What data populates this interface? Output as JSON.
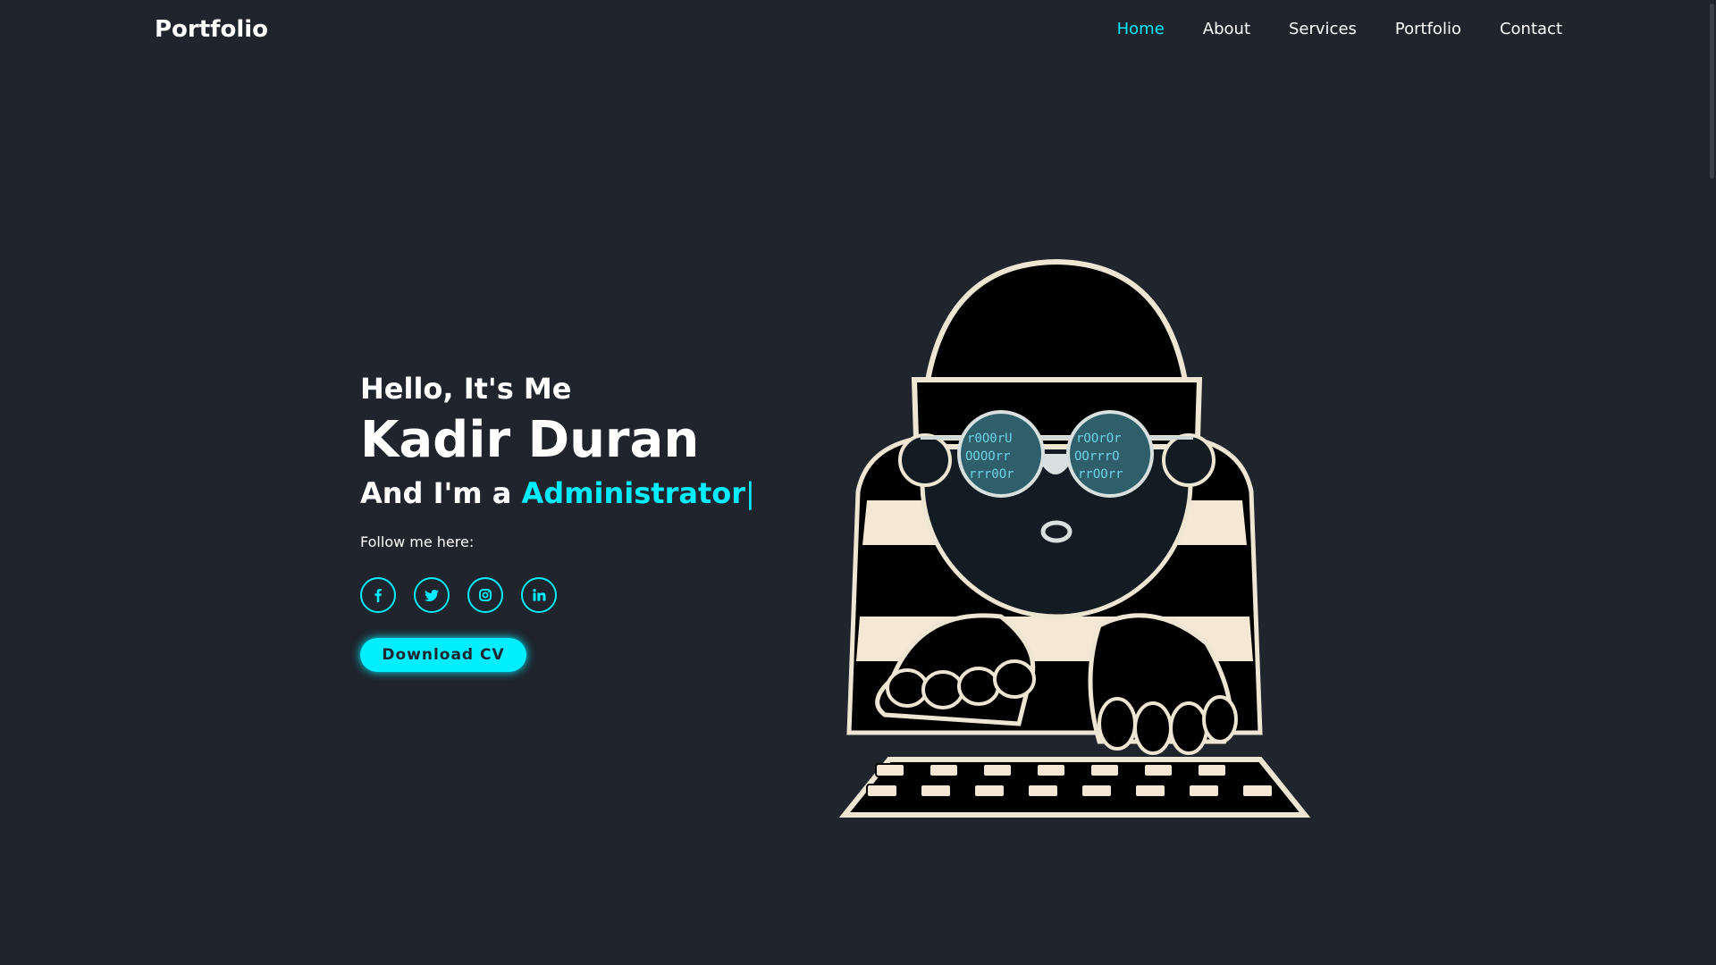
{
  "header": {
    "logo": "Portfolio",
    "nav": [
      {
        "label": "Home",
        "active": true
      },
      {
        "label": "About",
        "active": false
      },
      {
        "label": "Services",
        "active": false
      },
      {
        "label": "Portfolio",
        "active": false
      },
      {
        "label": "Contact",
        "active": false
      }
    ]
  },
  "hero": {
    "greeting": "Hello, It's Me",
    "name": "Kadir Duran",
    "role_prefix": "And I'm a",
    "role": "Administrator",
    "caret": "|",
    "follow_label": "Follow me here:",
    "socials": [
      {
        "icon": "facebook-icon"
      },
      {
        "icon": "twitter-icon"
      },
      {
        "icon": "instagram-icon"
      },
      {
        "icon": "linkedin-icon"
      }
    ],
    "cv_button": "Download CV"
  },
  "colors": {
    "background": "#1f242d",
    "accent": "#00eeff",
    "text": "#ffffff"
  }
}
